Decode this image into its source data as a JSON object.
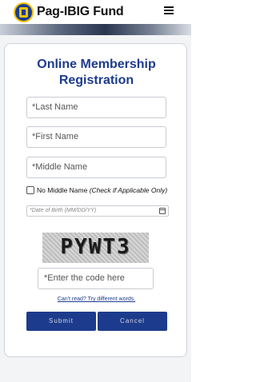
{
  "header": {
    "brand": "Pag-IBIG Fund",
    "logo_icon": "pagibig-logo-icon",
    "menu_icon": "hamburger-icon"
  },
  "form": {
    "title": "Online Membership Registration",
    "last_name_placeholder": "*Last Name",
    "first_name_placeholder": "*First Name",
    "middle_name_placeholder": "*Middle Name",
    "no_middle_name_label": "No Middle Name",
    "no_middle_name_hint": "(Check if Applicable Only)",
    "dob_placeholder": "*Date of Birth (MM/DD/YY)",
    "captcha_text": "PYWT3",
    "code_placeholder": "*Enter the code here",
    "cant_read_link": "Can't read? Try different words.",
    "submit_label": "Submit",
    "cancel_label": "Cancel"
  },
  "colors": {
    "brand_blue": "#1d3b8c",
    "brand_yellow": "#f2c200"
  }
}
